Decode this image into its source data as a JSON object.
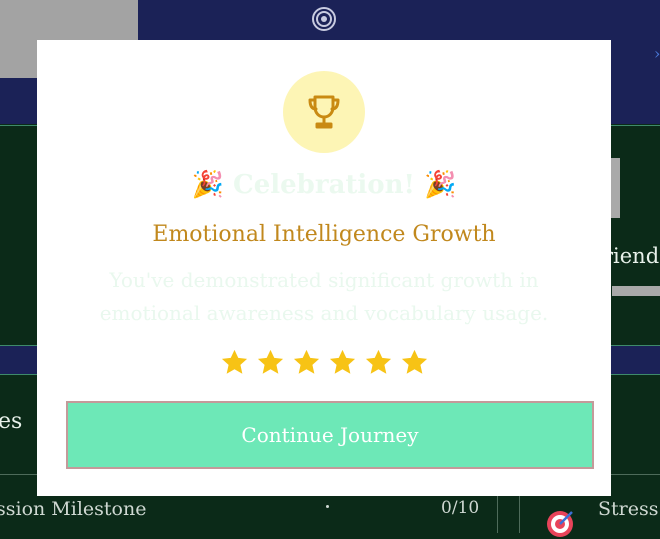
{
  "background": {
    "partial_label_right": "riend",
    "partial_label_left": "es",
    "milestone_label": "ssion Milestone",
    "milestone_count": "0/10",
    "stress_label": "Stress"
  },
  "modal": {
    "icon": "trophy-icon",
    "heading_emoji": "🎉",
    "heading": "Celebration!",
    "title": "Emotional Intelligence Growth",
    "description": "You've demonstrated significant growth in emotional awareness and vocabulary usage.",
    "rating": 6,
    "button_label": "Continue Journey"
  },
  "colors": {
    "trophy": "#c98a12",
    "trophy_bg": "#fdf5b5",
    "title": "#c1881d",
    "star": "#f7c315",
    "button_bg": "#6de8b7",
    "button_border": "#c49a9a"
  }
}
